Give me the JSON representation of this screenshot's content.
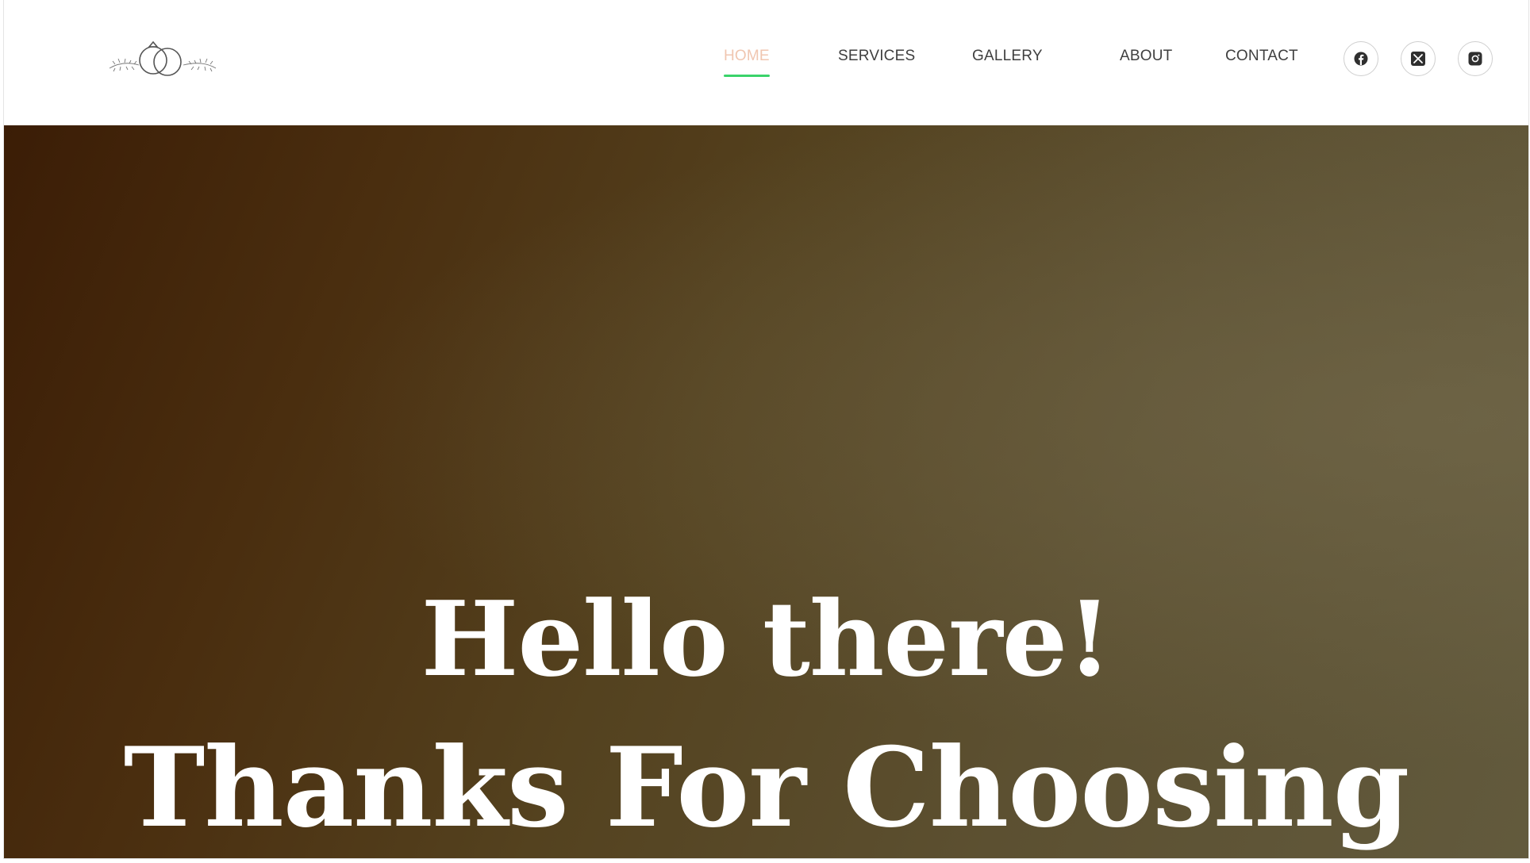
{
  "header": {
    "logo_icon": "wedding-rings-icon",
    "nav": [
      {
        "label": "HOME",
        "active": true
      },
      {
        "label": "SERVICES",
        "active": false
      },
      {
        "label": "GALLERY",
        "active": false
      },
      {
        "label": "ABOUT",
        "active": false
      },
      {
        "label": "CONTACT",
        "active": false
      }
    ],
    "social": [
      {
        "icon": "facebook-icon"
      },
      {
        "icon": "x-twitter-icon"
      },
      {
        "icon": "instagram-icon"
      }
    ]
  },
  "hero": {
    "line1": "Hello there!",
    "line2": "Thanks For Choosing"
  },
  "colors": {
    "nav_text": "#3f3f3f",
    "nav_active_text": "#f0c6b0",
    "nav_active_underline": "#3ad36a",
    "hero_text": "#ffffff",
    "hero_bg_dark": "#3b1d06",
    "hero_bg_light": "#625a3d"
  }
}
